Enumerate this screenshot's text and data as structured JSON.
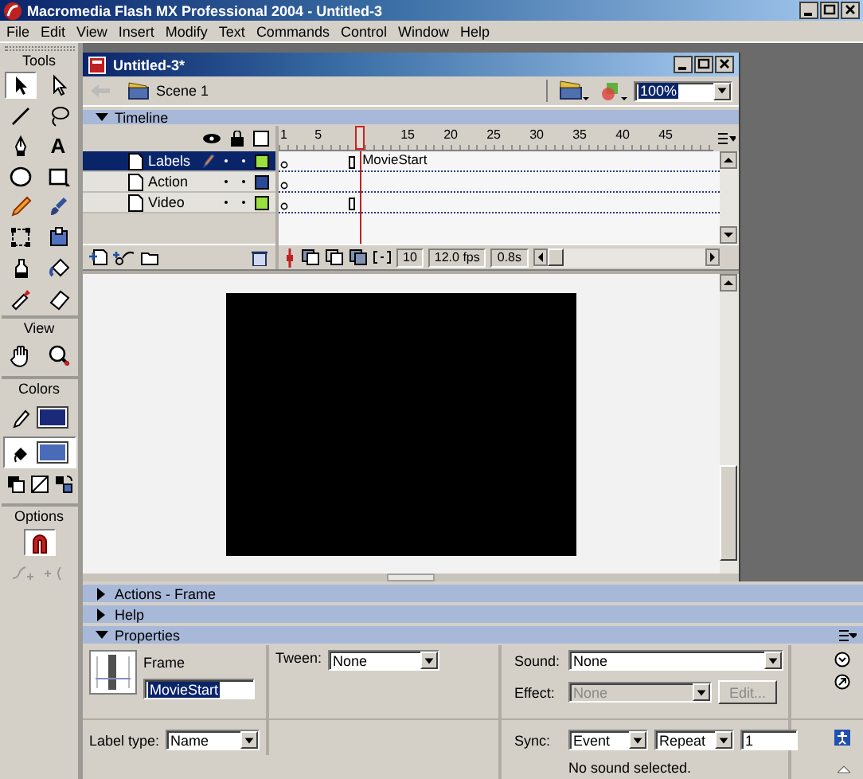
{
  "app_window": {
    "title": "Macromedia Flash MX Professional 2004 - Untitled-3"
  },
  "menu": [
    "File",
    "Edit",
    "View",
    "Insert",
    "Modify",
    "Text",
    "Commands",
    "Control",
    "Window",
    "Help"
  ],
  "tools_panel": {
    "title": "Tools",
    "tools": [
      {
        "selected": true
      },
      {
        "selected": false
      },
      {
        "selected": false
      },
      {
        "selected": false
      },
      {
        "selected": false
      },
      {
        "selected": false,
        "glyph": "A"
      },
      {
        "selected": false
      },
      {
        "selected": false
      },
      {
        "selected": false
      },
      {
        "selected": false
      },
      {
        "selected": false
      },
      {
        "selected": false
      },
      {
        "selected": false
      },
      {
        "selected": false
      },
      {
        "selected": false
      },
      {
        "selected": false
      }
    ],
    "view_title": "View",
    "colors_title": "Colors",
    "fill_selected": true,
    "options_title": "Options",
    "snap_on": true
  },
  "document": {
    "title": "Untitled-3*",
    "scene": "Scene 1",
    "zoom": "100%"
  },
  "timeline": {
    "title": "Timeline",
    "ruler": [
      "1",
      "5",
      "15",
      "20",
      "25",
      "30",
      "35",
      "40",
      "45"
    ],
    "layers": [
      {
        "name": "Labels",
        "selected": true,
        "color": "#99e040",
        "span": true,
        "frame_label": "MovieStart"
      },
      {
        "name": "Action",
        "selected": false,
        "color": "#2a4a98",
        "span": false
      },
      {
        "name": "Video",
        "selected": false,
        "color": "#99e040",
        "span": true
      }
    ],
    "current_frame": "10",
    "frame_rate": "12.0 fps",
    "elapsed": "0.8s"
  },
  "panels": [
    {
      "title": "Actions - Frame",
      "expanded": false
    },
    {
      "title": "Help",
      "expanded": false
    },
    {
      "title": "Properties",
      "expanded": true
    }
  ],
  "properties": {
    "type": "Frame",
    "frame_label": "MovieStart",
    "label_type_label": "Label type:",
    "label_type": "Name",
    "tween_label": "Tween:",
    "tween": "None",
    "sound_label": "Sound:",
    "sound": "None",
    "effect_label": "Effect:",
    "effect": {
      "value": "None",
      "disabled": true
    },
    "edit_button": {
      "label": "Edit...",
      "disabled": true
    },
    "sync_label": "Sync:",
    "sync": "Event",
    "repeat": "Repeat",
    "repeat_count": "1",
    "sound_status": "No sound selected."
  }
}
